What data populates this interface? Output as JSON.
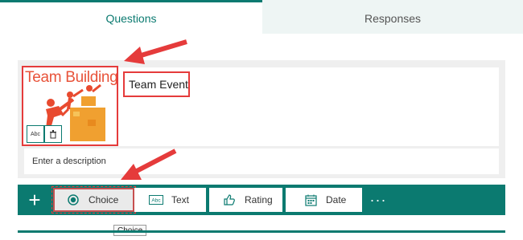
{
  "tabs": [
    {
      "label": "Questions",
      "active": true
    },
    {
      "label": "Responses",
      "active": false
    }
  ],
  "form": {
    "image_title": "Team Building",
    "title": "Team Event",
    "description_placeholder": "Enter a description"
  },
  "toolbar": {
    "add_label": "+",
    "buttons": [
      {
        "label": "Choice",
        "icon": "radio-icon"
      },
      {
        "label": "Text",
        "icon": "text-icon"
      },
      {
        "label": "Rating",
        "icon": "thumbs-up-icon"
      },
      {
        "label": "Date",
        "icon": "calendar-icon"
      }
    ],
    "more_label": "···"
  },
  "tooltip": "Choice",
  "colors": {
    "accent": "#0b7a70",
    "highlight": "#e53b3b"
  }
}
